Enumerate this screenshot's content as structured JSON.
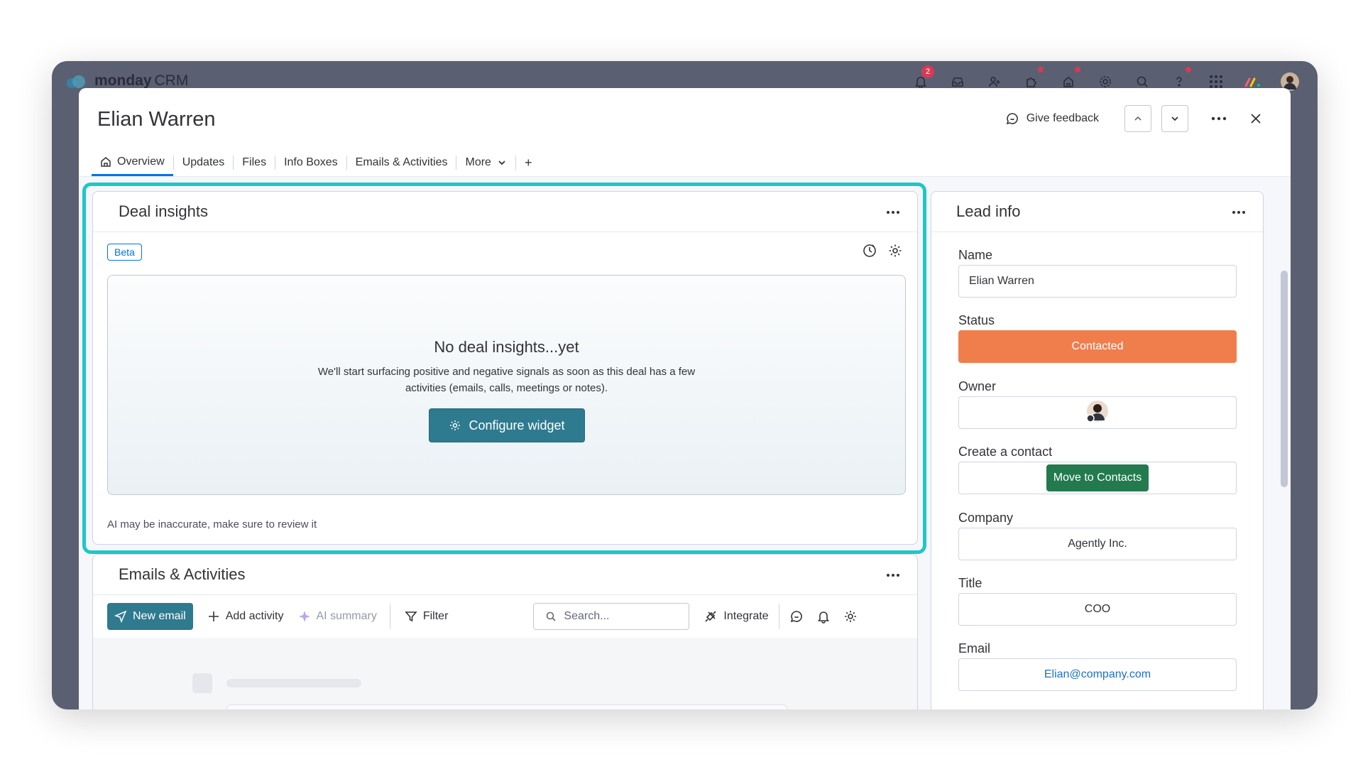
{
  "app": {
    "brand_bold": "monday",
    "brand_light": "CRM",
    "notification_count": "2"
  },
  "item": {
    "title": "Elian Warren"
  },
  "header_actions": {
    "feedback": "Give feedback"
  },
  "tabs": [
    {
      "label": "Overview"
    },
    {
      "label": "Updates"
    },
    {
      "label": "Files"
    },
    {
      "label": "Info Boxes"
    },
    {
      "label": "Emails & Activities"
    },
    {
      "label": "More"
    },
    {
      "label": "+"
    }
  ],
  "deal_insights": {
    "title": "Deal insights",
    "badge": "Beta",
    "empty_title": "No deal insights...yet",
    "empty_desc": "We'll start surfacing positive and negative signals as soon as this deal has a few activities (emails, calls, meetings or notes).",
    "configure_label": "Configure widget",
    "disclaimer": "AI may be inaccurate, make sure to review it"
  },
  "emails_activities": {
    "title": "Emails & Activities",
    "new_email": "New email",
    "add_activity": "Add activity",
    "ai_summary": "AI summary",
    "filter": "Filter",
    "search_placeholder": "Search...",
    "integrate": "Integrate"
  },
  "lead_info": {
    "title": "Lead info",
    "fields": {
      "name": {
        "label": "Name",
        "value": "Elian Warren"
      },
      "status": {
        "label": "Status",
        "value": "Contacted",
        "color": "#f07e4d"
      },
      "owner": {
        "label": "Owner"
      },
      "create_contact": {
        "label": "Create a contact",
        "button": "Move to Contacts"
      },
      "company": {
        "label": "Company",
        "value": "Agently Inc."
      },
      "title": {
        "label": "Title",
        "value": "COO"
      },
      "email": {
        "label": "Email",
        "value": "Elian@company.com"
      }
    }
  },
  "colors": {
    "accent": "#0073ea",
    "highlight": "#1ec7c7",
    "primary_button": "#2e7a8f",
    "move_button": "#237a4e"
  }
}
